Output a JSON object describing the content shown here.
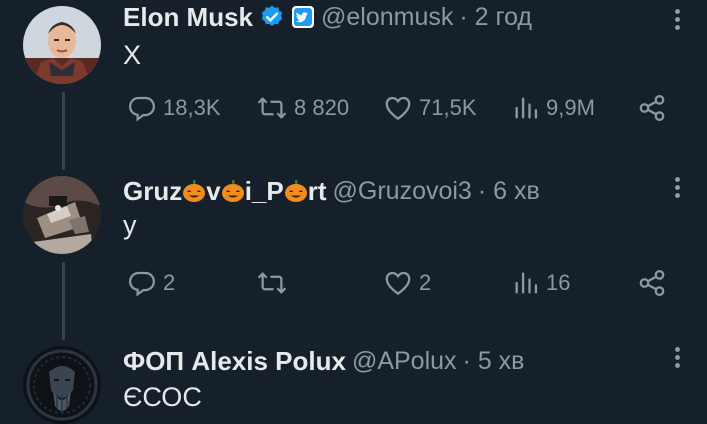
{
  "tweets": [
    {
      "name": "Elon Musk",
      "handle": "@elonmusk",
      "time": "· 2 год",
      "text": "X",
      "stats": {
        "replies": "18,3K",
        "retweets": "8 820",
        "likes": "71,5K",
        "views": "9,9M"
      }
    },
    {
      "name_parts": [
        "Gruz",
        "v",
        "i_P",
        "rt"
      ],
      "handle": "@Gruzovoi3",
      "time": "· 6 хв",
      "text": "у",
      "stats": {
        "replies": "2",
        "retweets": "",
        "likes": "2",
        "views": "16"
      }
    },
    {
      "name": "ФОП Alexis Polux",
      "handle": "@APolux",
      "time": "· 5 хв",
      "text": "ЄСОС"
    }
  ],
  "colors": {
    "background": "#15202b",
    "text": "#e7e9ea",
    "muted": "#8b98a5",
    "verified": "#1d9bf0",
    "thread_line": "#38444d"
  },
  "icons": [
    "verified-badge-icon",
    "square-badge-icon",
    "reply-icon",
    "retweet-icon",
    "like-icon",
    "views-icon",
    "share-icon",
    "more-icon",
    "pumpkin-icon"
  ]
}
